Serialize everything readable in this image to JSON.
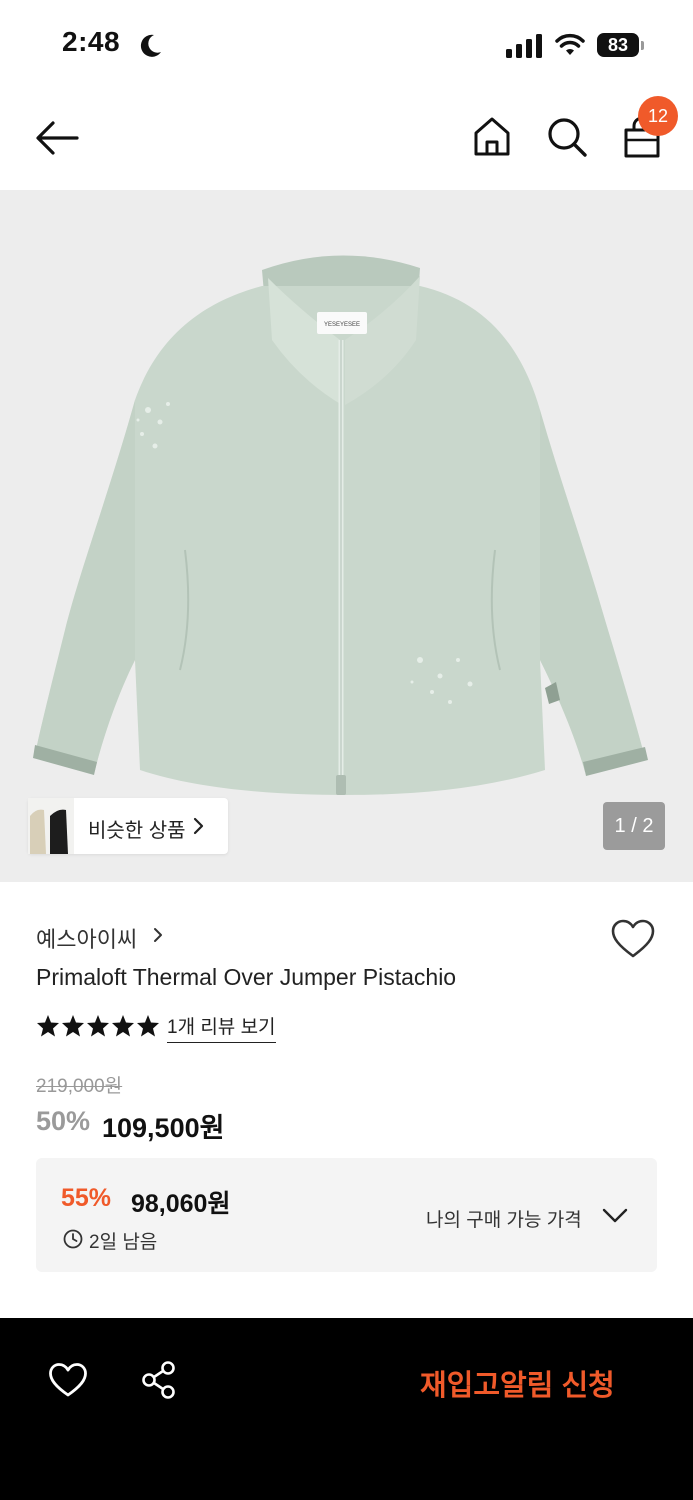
{
  "status_bar": {
    "time": "2:48",
    "battery": "83"
  },
  "header": {
    "cart_count": "12"
  },
  "gallery": {
    "similar_label": "비슷한 상품",
    "page_indicator": "1 / 2",
    "label_text": "YESEYESEE"
  },
  "product": {
    "brand": "예스아이씨",
    "title": "Primaloft Thermal Over Jumper Pistachio",
    "rating_stars": 5,
    "review_link": "1개 리뷰 보기",
    "original_price": "219,000원",
    "discount_rate": "50%",
    "sale_price": "109,500원"
  },
  "my_price": {
    "rate": "55%",
    "price": "98,060원",
    "remaining": "2일 남음",
    "label": "나의 구매 가능 가격"
  },
  "bottom_bar": {
    "restock_label": "재입고알림 신청"
  },
  "colors": {
    "accent": "#f05a2a",
    "jacket": "#c9d7cc",
    "image_bg": "#ededed"
  }
}
